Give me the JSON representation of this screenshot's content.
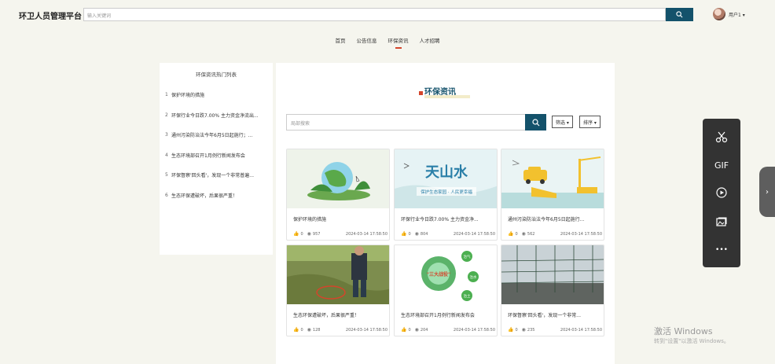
{
  "header": {
    "brand": "环卫人员管理平台",
    "search_placeholder": "输入关键词",
    "user_name": "用户1 ▾"
  },
  "nav": {
    "items": [
      "首页",
      "公告信息",
      "环保资讯",
      "人才招聘"
    ],
    "active_index": 2
  },
  "sidebar": {
    "title": "环保资讯热门列表",
    "items": [
      {
        "num": "1",
        "label": "保护环境的措施"
      },
      {
        "num": "2",
        "label": "环保行业今日跌7.00% 主力资金净流出..."
      },
      {
        "num": "3",
        "label": "通州污染防治法今年6月5日起施行；..."
      },
      {
        "num": "4",
        "label": "生态环境部召开1月例行新闻发布会"
      },
      {
        "num": "5",
        "label": "环保督察'回头看'，发现一个非常普遍..."
      },
      {
        "num": "6",
        "label": "生态环保遭破坏，后果很严重！"
      }
    ]
  },
  "main": {
    "title": "环保资讯",
    "local_search_placeholder": "局部搜索",
    "filter_label": "筛选 ▾",
    "sort_label": "排序 ▾"
  },
  "cards": [
    {
      "title": "保护环境的措施",
      "likes": "0",
      "views": "957",
      "date": "2024-03-14 17:58:50"
    },
    {
      "title": "环保行业今日跌7.00% 主力资金净...",
      "likes": "0",
      "views": "804",
      "date": "2024-03-14 17:58:50"
    },
    {
      "title": "通州污染防治法今年6月5日起施行...",
      "likes": "0",
      "views": "562",
      "date": "2024-03-14 17:58:50"
    },
    {
      "title": "生态环保遭破坏，后果很严重！",
      "likes": "0",
      "views": "128",
      "date": "2024-03-14 17:58:50"
    },
    {
      "title": "生态环境部召开1月例行新闻发布会",
      "likes": "0",
      "views": "204",
      "date": "2024-03-14 17:58:50"
    },
    {
      "title": "环保督察'回头看'，发现一个非常...",
      "likes": "0",
      "views": "235",
      "date": "2024-03-14 17:58:50"
    }
  ],
  "card_images": {
    "card2_text": "天山水",
    "card2_sub": "保护生态家园 · 人民更幸福",
    "card5_center": "\"三大战役\"",
    "card5_tag1": "治气",
    "card5_tag2": "治水",
    "card5_tag3": "治土"
  },
  "toolbar": {
    "gif_label": "GIF",
    "more_label": "•••",
    "expand_label": "›"
  },
  "watermark": {
    "line1": "激活 Windows",
    "line2": "转到\"设置\"以激活 Windows。"
  },
  "colors": {
    "accent": "#14526b",
    "highlight": "#d4452b",
    "page_bg": "#f5f5ee"
  }
}
